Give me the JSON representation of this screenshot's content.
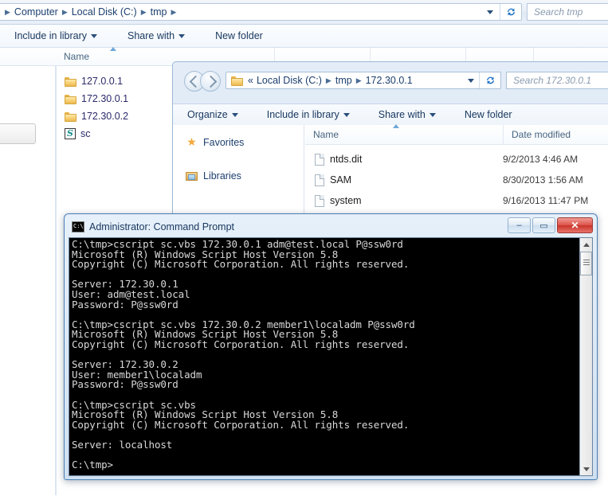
{
  "window1": {
    "title": "tmp",
    "address": {
      "crumbs": [
        "Computer",
        "Local Disk (C:)",
        "tmp"
      ],
      "dropdown_icon": "chevron-down-icon",
      "refresh_icon": "refresh-icon"
    },
    "search": {
      "placeholder": "Search tmp"
    },
    "toolbar": [
      {
        "label": "Include in library",
        "caret": true
      },
      {
        "label": "Share with",
        "caret": true
      },
      {
        "label": "New folder",
        "caret": false
      }
    ],
    "columns": [
      {
        "label": "Name"
      },
      {
        "label": ""
      },
      {
        "label": ""
      },
      {
        "label": ""
      },
      {
        "label": ""
      }
    ],
    "files": [
      {
        "name": "127.0.0.1",
        "icon": "folder-icon"
      },
      {
        "name": "172.30.0.1",
        "icon": "folder-icon"
      },
      {
        "name": "172.30.0.2",
        "icon": "folder-icon"
      },
      {
        "name": "sc",
        "icon": "vbscript-file-icon"
      }
    ]
  },
  "window2": {
    "address": {
      "overflow": "«",
      "crumbs": [
        "Local Disk (C:)",
        "tmp",
        "172.30.0.1"
      ],
      "dropdown_icon": "chevron-down-icon",
      "refresh_icon": "refresh-icon"
    },
    "back_icon": "back-arrow-icon",
    "forward_icon": "forward-arrow-icon",
    "search": {
      "placeholder": "Search 172.30.0.1"
    },
    "toolbar": [
      {
        "label": "Organize",
        "caret": true
      },
      {
        "label": "Include in library",
        "caret": true
      },
      {
        "label": "Share with",
        "caret": true
      },
      {
        "label": "New folder",
        "caret": false
      }
    ],
    "navpane": [
      {
        "label": "Favorites",
        "icon": "star-icon"
      },
      {
        "label": "Libraries",
        "icon": "library-icon"
      }
    ],
    "columns": [
      {
        "label": "Name"
      },
      {
        "label": "Date modified"
      }
    ],
    "files": [
      {
        "name": "ntds.dit",
        "date": "9/2/2013 4:46 AM",
        "icon": "document-icon"
      },
      {
        "name": "SAM",
        "date": "8/30/2013 1:56 AM",
        "icon": "document-icon"
      },
      {
        "name": "system",
        "date": "9/16/2013 11:47 PM",
        "icon": "document-icon"
      }
    ]
  },
  "console": {
    "title": "Administrator: Command Prompt",
    "icon": "command-prompt-icon",
    "buttons": {
      "minimize": "–",
      "maximize": "▭",
      "close": "✕"
    },
    "text": "C:\\tmp>cscript sc.vbs 172.30.0.1 adm@test.local P@ssw0rd\nMicrosoft (R) Windows Script Host Version 5.8\nCopyright (C) Microsoft Corporation. All rights reserved.\n\nServer: 172.30.0.1\nUser: adm@test.local\nPassword: P@ssw0rd\n\nC:\\tmp>cscript sc.vbs 172.30.0.2 member1\\localadm P@ssw0rd\nMicrosoft (R) Windows Script Host Version 5.8\nCopyright (C) Microsoft Corporation. All rights reserved.\n\nServer: 172.30.0.2\nUser: member1\\localadm\nPassword: P@ssw0rd\n\nC:\\tmp>cscript sc.vbs\nMicrosoft (R) Windows Script Host Version 5.8\nCopyright (C) Microsoft Corporation. All rights reserved.\n\nServer: localhost\n\nC:\\tmp>"
  },
  "colors": {
    "console_bg": "#000000",
    "console_fg": "#d8d8d8",
    "link_blue": "#1c3f6e",
    "close_red": "#c9342b"
  }
}
